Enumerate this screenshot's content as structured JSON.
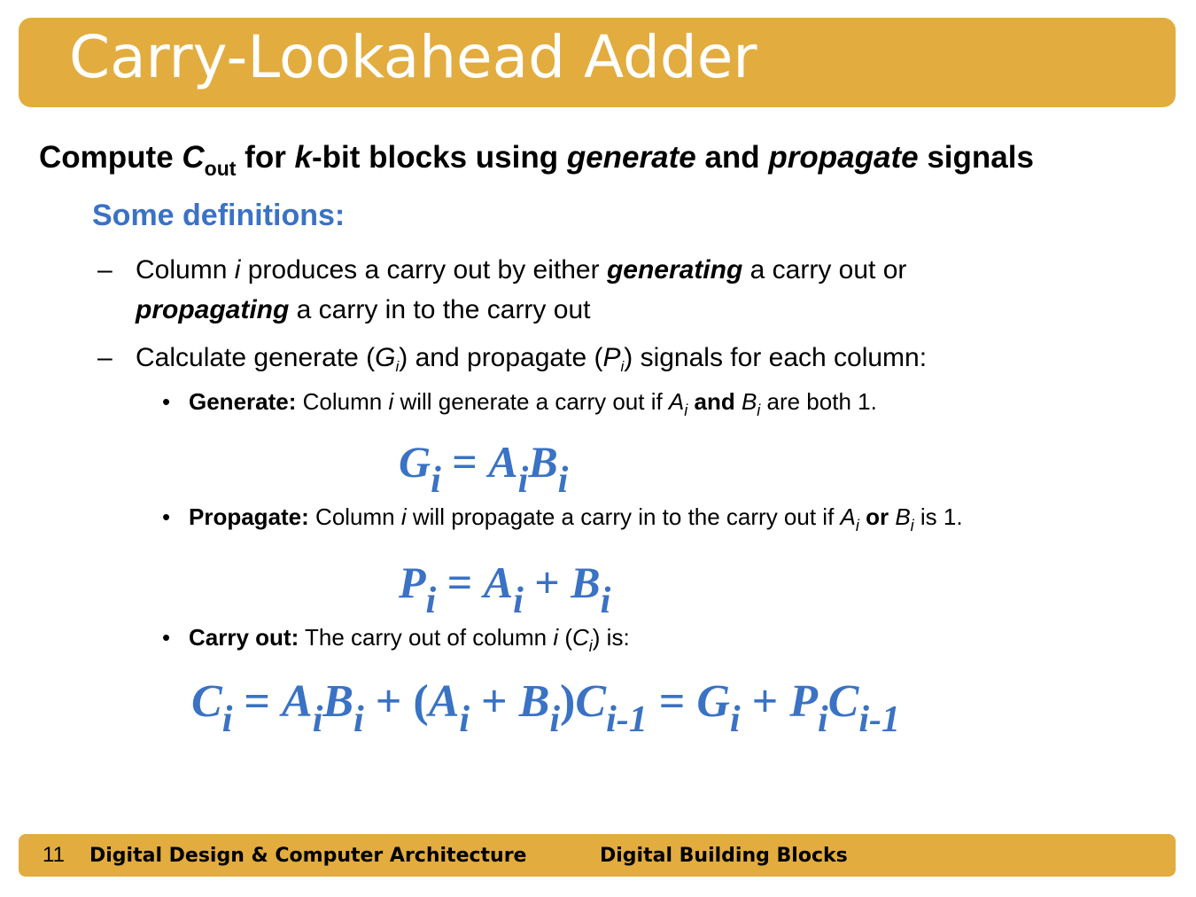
{
  "title": "Carry-Lookahead Adder",
  "headline": {
    "part1": "Compute ",
    "c": "C",
    "c_sub": "out",
    "part2": " for ",
    "k": "k",
    "part3": "-bit blocks using ",
    "generate": "generate",
    "part4": " and ",
    "propagate": "propagate",
    "part5": " signals"
  },
  "definitions_heading": "Some definitions:",
  "dash_items": [
    {
      "dash": "–",
      "line1_a": "Column ",
      "line1_i": "i",
      "line1_b": " produces a carry out by either ",
      "line1_gen": "generating",
      "line1_c": " a carry out or",
      "line2_prop": "propagating",
      "line2_b": " a carry in to the carry out"
    },
    {
      "dash": "–",
      "a": "Calculate generate (",
      "g": "G",
      "g_sub": "i",
      "b": ") and propagate (",
      "p": "P",
      "p_sub": "i",
      "c": ") signals for each column:"
    }
  ],
  "bullets": {
    "dot": "•",
    "generate": {
      "label": "Generate:",
      "a": " Column ",
      "i": "i",
      "b": " will generate a carry out if ",
      "A": "A",
      "A_sub": "i",
      "and": " and ",
      "B": "B",
      "B_sub": "i",
      "c": " are both 1."
    },
    "propagate": {
      "label": "Propagate:",
      "a": " Column ",
      "i": "i",
      "b": " will propagate a carry in to the carry out if ",
      "A": "A",
      "A_sub": "i",
      "or": " or ",
      "B": "B",
      "B_sub": "i",
      "c": " is 1."
    },
    "carry": {
      "label": "Carry out:",
      "a": " The carry out of column ",
      "i": "i",
      "b": " (",
      "C": "C",
      "C_sub": "i",
      "c": ") is:"
    }
  },
  "equations": {
    "generate": {
      "G": "G",
      "i": "i",
      "eq": " = ",
      "A": "A",
      "B": "B"
    },
    "propagate": {
      "P": "P",
      "i": "i",
      "eq": " = ",
      "A": "A",
      "plus": " + ",
      "B": "B"
    },
    "carry": {
      "C": "C",
      "i": "i",
      "eq": " = ",
      "A": "A",
      "B": "B",
      "plus": " + ",
      "lparen": "(",
      "rparen": ")",
      "im1": "i-1",
      "G": "G",
      "P": "P"
    }
  },
  "footer": {
    "page": "11",
    "book": "Digital Design & Computer Architecture",
    "chapter": "Digital Building Blocks"
  },
  "colors": {
    "accent_bar": "#E2AC3F",
    "heading_blue": "#3A72C4"
  }
}
